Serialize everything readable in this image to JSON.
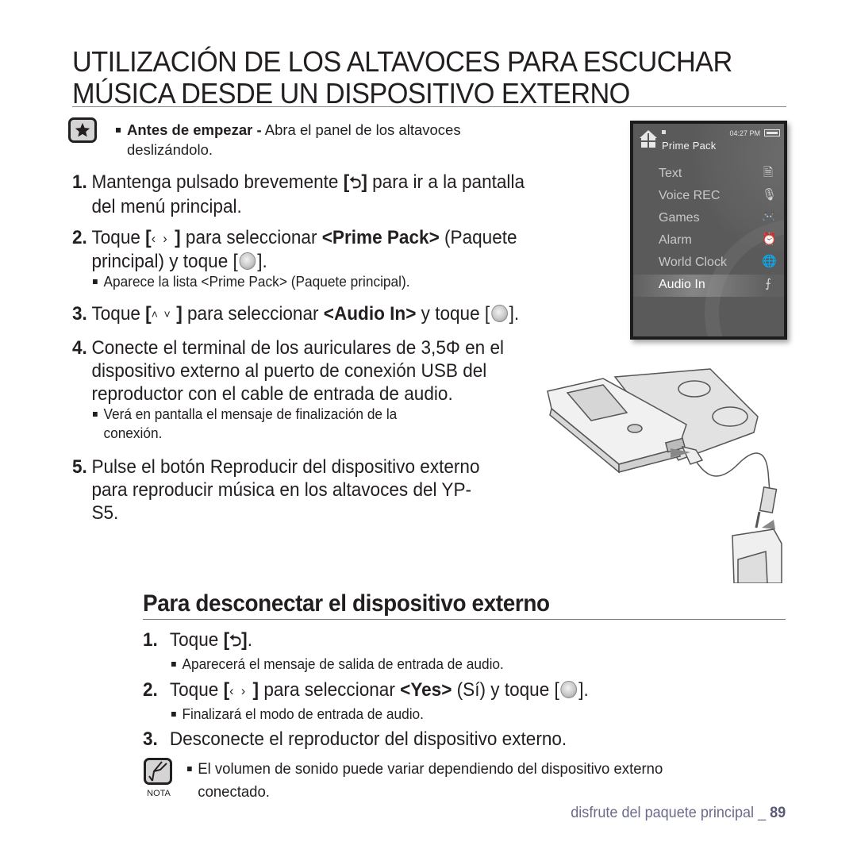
{
  "title": {
    "line1": "UTILIZACIÓN DE LOS ALTAVOCES PARA ESCUCHAR",
    "line2": "MÚSICA DESDE UN DISPOSITIVO EXTERNO"
  },
  "tip": {
    "icon": "star-icon",
    "bold": "Antes de empezar -",
    "text": " Abra el panel de los altavoces",
    "line2": "deslizándolo."
  },
  "steps": [
    {
      "num": "1.",
      "a": "Mantenga pulsado brevemente ",
      "btn": "back-icon",
      "b": " para ir a la pantalla",
      "line2": "del menú principal."
    },
    {
      "num": "2.",
      "a": "Toque ",
      "btn": "left-right-icon",
      "b": " para seleccionar ",
      "bold": "<Prime Pack>",
      "c": " (Paquete",
      "line2a": "principal) y toque [",
      "line2b": "].",
      "sub": "Aparece la lista <Prime Pack> (Paquete principal)."
    },
    {
      "num": "3.",
      "a": "Toque ",
      "btn": "up-down-icon",
      "b": " para seleccionar ",
      "bold": "<Audio In>",
      "c": " y toque [",
      "d": "]."
    },
    {
      "num": "4.",
      "line1": "Conecte el terminal de los auriculares de 3,5Φ en el",
      "line2": "dispositivo externo al puerto de conexión USB del",
      "line3": "reproductor con el cable de entrada de audio.",
      "sub1": "Verá en pantalla el mensaje de finalización de la",
      "sub2": "conexión."
    },
    {
      "num": "5.",
      "line1": "Pulse el botón Reproducir del dispositivo externo",
      "line2": "para reproducir música en los altavoces del YP-",
      "line3": "S5."
    }
  ],
  "screen": {
    "time": "04:27 PM",
    "title": "Prime Pack",
    "items": [
      {
        "label": "Text",
        "icon": "document-icon",
        "selected": false
      },
      {
        "label": "Voice REC",
        "icon": "microphone-icon",
        "selected": false
      },
      {
        "label": "Games",
        "icon": "gamepad-icon",
        "selected": false
      },
      {
        "label": "Alarm",
        "icon": "alarm-clock-icon",
        "selected": false
      },
      {
        "label": "World Clock",
        "icon": "globe-icon",
        "selected": false
      },
      {
        "label": "Audio In",
        "icon": "audio-in-icon",
        "selected": true
      }
    ]
  },
  "disconnect": {
    "heading": "Para desconectar el dispositivo externo",
    "steps": [
      {
        "num": "1.",
        "a": "Toque ",
        "c": ".",
        "sub": "Aparecerá el mensaje de salida de entrada de audio."
      },
      {
        "num": "2.",
        "a": "Toque ",
        "b": " para seleccionar ",
        "bold": "<Yes>",
        "c": " (Sí) y toque [",
        "d": "].",
        "sub": "Finalizará el modo de entrada de audio."
      },
      {
        "num": "3.",
        "a": "Desconecte el reproductor del dispositivo externo."
      }
    ]
  },
  "note": {
    "label": "NOTA",
    "line1": "El volumen de sonido puede variar dependiendo del dispositivo externo",
    "line2": "conectado."
  },
  "footer": {
    "text": "disfrute del paquete principal _ ",
    "page": "89"
  }
}
